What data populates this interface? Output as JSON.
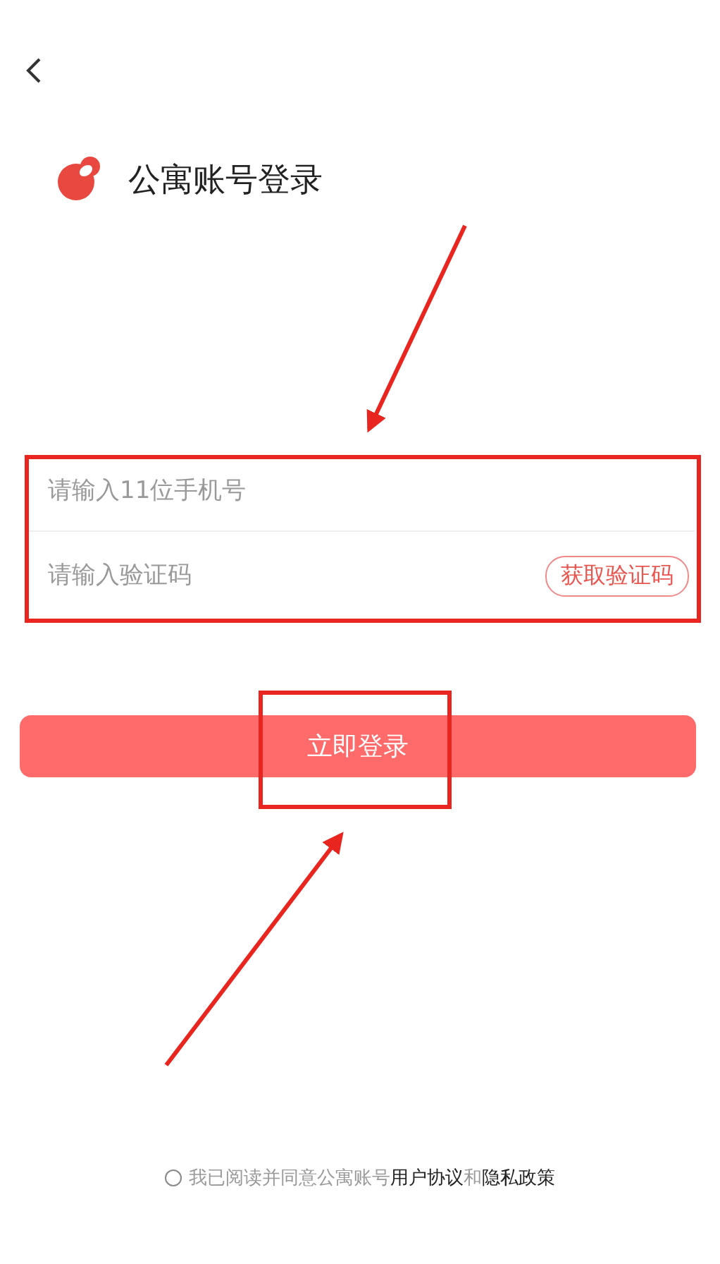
{
  "header": {
    "title": "公寓账号登录"
  },
  "form": {
    "phone": {
      "placeholder": "请输入11位手机号"
    },
    "code": {
      "placeholder": "请输入验证码",
      "button": "获取验证码"
    }
  },
  "login_button": "立即登录",
  "agreement": {
    "checked": false,
    "text": "我已阅读并同意公寓账号",
    "links": [
      "用户协议",
      "隐私政策"
    ],
    "joiner": "和"
  }
}
